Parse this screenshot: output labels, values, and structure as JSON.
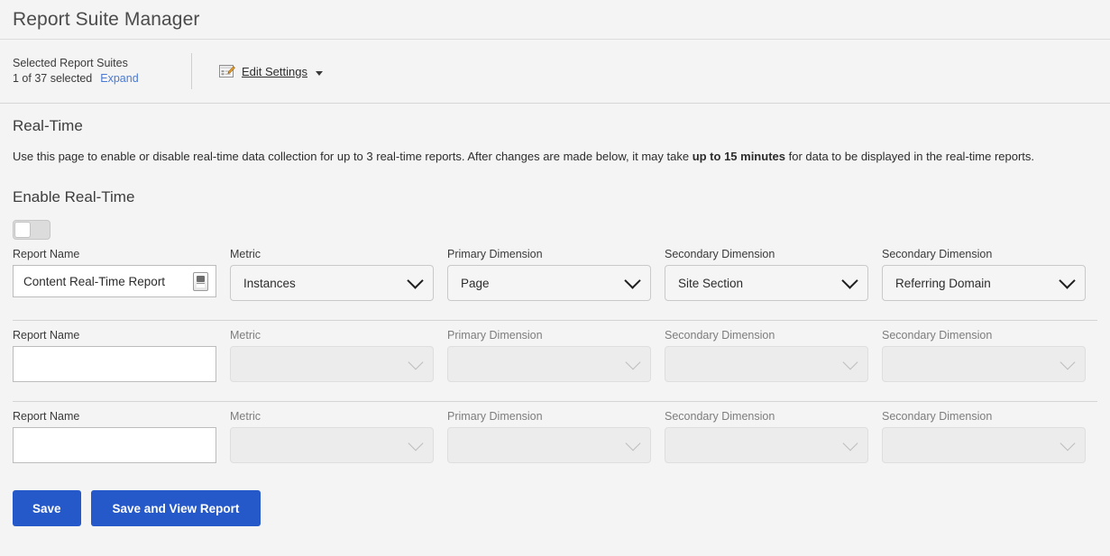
{
  "header": {
    "title": "Report Suite Manager"
  },
  "toolbar": {
    "suites_title": "Selected Report Suites",
    "suites_count": "1 of 37 selected",
    "expand_label": "Expand",
    "edit_settings_label": "Edit Settings",
    "edit_icon": "edit-document-icon",
    "caret_icon": "caret-down-icon"
  },
  "section": {
    "heading": "Real-Time",
    "desc_part1": "Use this page to enable or disable real-time data collection for up to 3 real-time reports. After changes are made below, it may take ",
    "desc_bold": "up to 15 minutes",
    "desc_part2": " for data to be displayed in the real-time reports.",
    "sub_heading": "Enable Real-Time",
    "toggle_state": "off"
  },
  "labels": {
    "report_name": "Report Name",
    "metric": "Metric",
    "primary_dimension": "Primary Dimension",
    "secondary_dimension": "Secondary Dimension"
  },
  "rows": [
    {
      "enabled": true,
      "report_name_label": "Report Name",
      "report_name_value": "Content Real-Time Report",
      "stepper_icon": "stepper-icon",
      "metric_label": "Metric",
      "metric_value": "Instances",
      "primary_label": "Primary Dimension",
      "primary_value": "Page",
      "secondary1_label": "Secondary Dimension",
      "secondary1_value": "Site Section",
      "secondary2_label": "Secondary Dimension",
      "secondary2_value": "Referring Domain"
    },
    {
      "enabled": false,
      "report_name_label": "Report Name",
      "report_name_value": "",
      "metric_label": "Metric",
      "metric_value": "",
      "primary_label": "Primary Dimension",
      "primary_value": "",
      "secondary1_label": "Secondary Dimension",
      "secondary1_value": "",
      "secondary2_label": "Secondary Dimension",
      "secondary2_value": ""
    },
    {
      "enabled": false,
      "report_name_label": "Report Name",
      "report_name_value": "",
      "metric_label": "Metric",
      "metric_value": "",
      "primary_label": "Primary Dimension",
      "primary_value": "",
      "secondary1_label": "Secondary Dimension",
      "secondary1_value": "",
      "secondary2_label": "Secondary Dimension",
      "secondary2_value": ""
    }
  ],
  "buttons": {
    "save": "Save",
    "save_and_view": "Save and View Report"
  },
  "colors": {
    "accent_blue": "#2558c8",
    "link_blue": "#4a7ad4",
    "page_bg": "#f4f4f4"
  }
}
